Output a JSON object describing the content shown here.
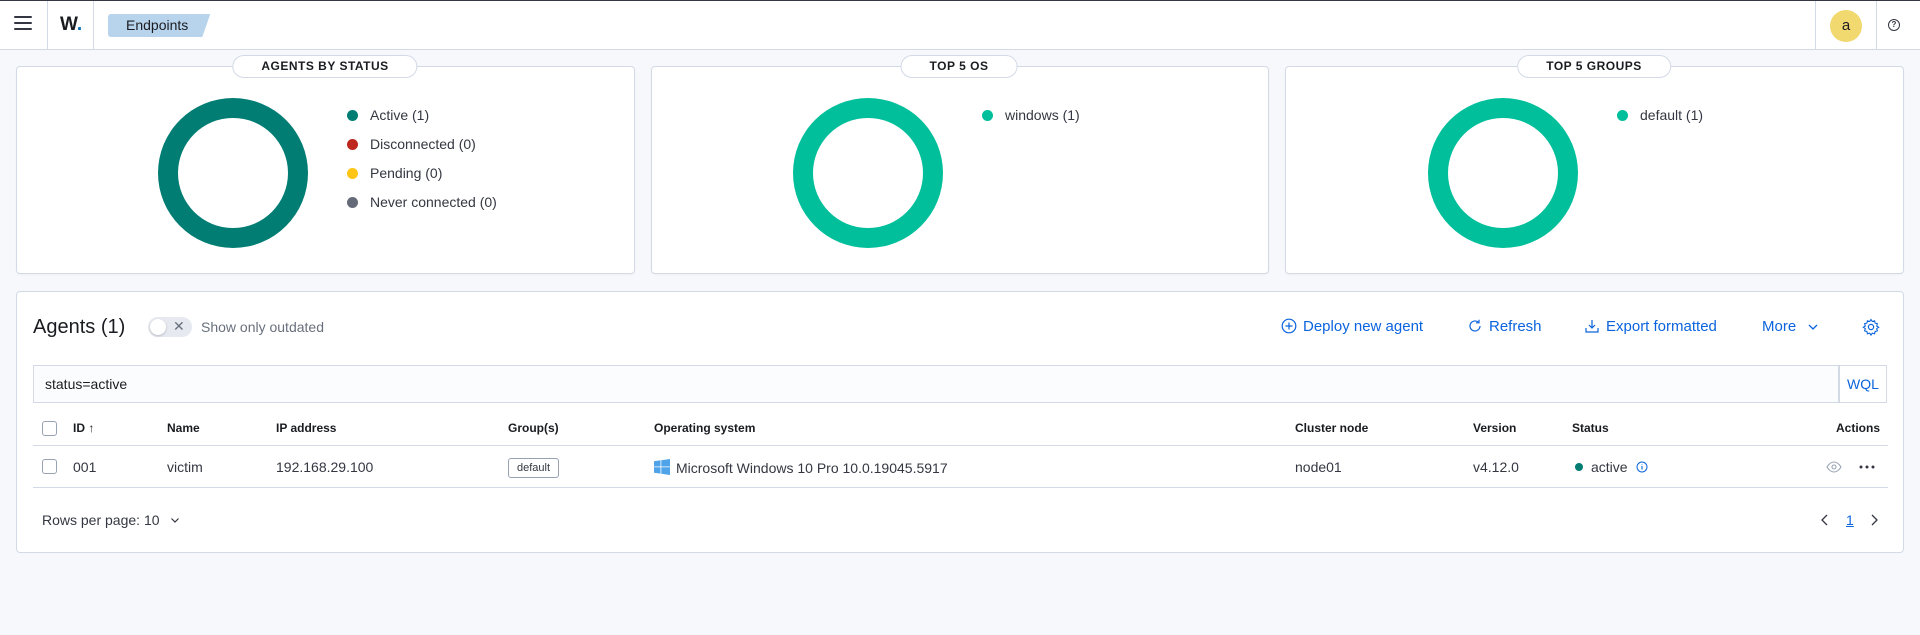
{
  "header": {
    "logo": "W",
    "breadcrumb": "Endpoints",
    "avatar": "a"
  },
  "cards": {
    "status": {
      "title": "AGENTS BY STATUS",
      "legend": [
        {
          "label": "Active (1)",
          "color": "#017d73"
        },
        {
          "label": "Disconnected (0)",
          "color": "#bd271e"
        },
        {
          "label": "Pending (0)",
          "color": "#fec514"
        },
        {
          "label": "Never connected (0)",
          "color": "#646a77"
        }
      ],
      "donut_color": "#017d73"
    },
    "os": {
      "title": "TOP 5 OS",
      "legend": [
        {
          "label": "windows (1)",
          "color": "#00bf9a"
        }
      ],
      "donut_color": "#00bf9a"
    },
    "groups": {
      "title": "TOP 5 GROUPS",
      "legend": [
        {
          "label": "default (1)",
          "color": "#00bf9a"
        }
      ],
      "donut_color": "#00bf9a"
    }
  },
  "agents": {
    "title": "Agents (1)",
    "toggle_label": "Show only outdated",
    "actions": {
      "deploy": "Deploy new agent",
      "refresh": "Refresh",
      "export": "Export formatted",
      "more": "More"
    },
    "search_value": "status=active",
    "wql": "WQL",
    "columns": {
      "id": "ID",
      "name": "Name",
      "ip": "IP address",
      "groups": "Group(s)",
      "os": "Operating system",
      "node": "Cluster node",
      "version": "Version",
      "status": "Status",
      "actions": "Actions"
    },
    "rows": [
      {
        "id": "001",
        "name": "victim",
        "ip": "192.168.29.100",
        "group": "default",
        "os": "Microsoft Windows 10 Pro 10.0.19045.5917",
        "node": "node01",
        "version": "v4.12.0",
        "status": "active"
      }
    ],
    "rows_per_page": "Rows per page: 10",
    "page": "1"
  }
}
